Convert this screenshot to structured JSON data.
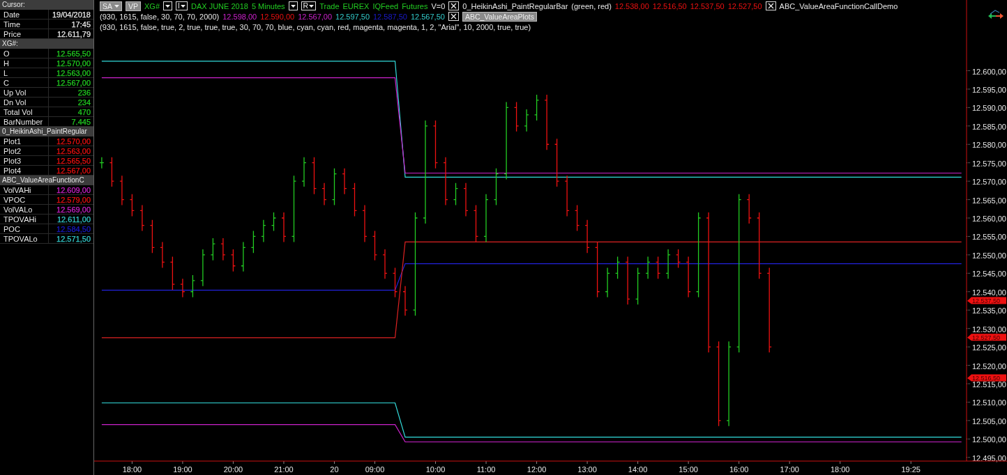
{
  "data_panel": {
    "sections": [
      {
        "title": "Cursor:",
        "rows": [
          {
            "label": "Date",
            "value": "19/04/2018",
            "color": "#e8e8e8"
          },
          {
            "label": "Time",
            "value": "17:45",
            "color": "#e8e8e8"
          },
          {
            "label": "Price",
            "value": "12.611,79",
            "color": "#e8e8e8"
          }
        ]
      },
      {
        "title": "XG#:",
        "rows": [
          {
            "label": "O",
            "value": "12.565,50",
            "color": "#22cc22"
          },
          {
            "label": "H",
            "value": "12.570,00",
            "color": "#22cc22"
          },
          {
            "label": "L",
            "value": "12.563,00",
            "color": "#22cc22"
          },
          {
            "label": "C",
            "value": "12.567,00",
            "color": "#22cc22"
          },
          {
            "label": "Up Vol",
            "value": "236",
            "color": "#22cc22"
          },
          {
            "label": "Dn Vol",
            "value": "234",
            "color": "#22cc22"
          },
          {
            "label": "Total Vol",
            "value": "470",
            "color": "#22cc22"
          },
          {
            "label": "BarNumber",
            "value": "7.445",
            "color": "#22cc22"
          }
        ]
      },
      {
        "title": "0_HeikinAshi_PaintRegular",
        "rows": [
          {
            "label": "Plot1",
            "value": "12.570,00",
            "color": "#ee1111"
          },
          {
            "label": "Plot2",
            "value": "12.563,00",
            "color": "#ee1111"
          },
          {
            "label": "Plot3",
            "value": "12.565,50",
            "color": "#ee1111"
          },
          {
            "label": "Plot4",
            "value": "12.567,00",
            "color": "#ee1111"
          }
        ]
      },
      {
        "title": "ABC_ValueAreaFunctionC",
        "rows": [
          {
            "label": "VolVAHi",
            "value": "12.609,00",
            "color": "#cc22cc"
          },
          {
            "label": "VPOC",
            "value": "12.579,00",
            "color": "#ee1111"
          },
          {
            "label": "VolVALo",
            "value": "12.569,00",
            "color": "#cc22cc"
          },
          {
            "label": "TPOVAHi",
            "value": "12.611,00",
            "color": "#33cccc"
          },
          {
            "label": "POC",
            "value": "12.584,50",
            "color": "#1a1acc"
          },
          {
            "label": "TPOVALo",
            "value": "12.571,50",
            "color": "#33cccc"
          }
        ]
      }
    ]
  },
  "legend": {
    "lines": [
      [
        {
          "kind": "button",
          "label": "SA",
          "dropdown": true
        },
        {
          "kind": "button",
          "label": "VP",
          "dropdown": false
        },
        {
          "kind": "text",
          "label": "XG#",
          "color": "#22cc22"
        },
        {
          "kind": "dropdown"
        },
        {
          "kind": "box",
          "label": "I",
          "dropdown": true
        },
        {
          "kind": "text",
          "label": "DAX JUNE 2018",
          "color": "#22cc22"
        },
        {
          "kind": "text",
          "label": "5 Minutes",
          "color": "#22cc22"
        },
        {
          "kind": "dropdown"
        },
        {
          "kind": "box",
          "label": "R",
          "dropdown": true
        },
        {
          "kind": "text",
          "label": "Trade",
          "color": "#22cc22"
        },
        {
          "kind": "text",
          "label": "EUREX",
          "color": "#22cc22"
        },
        {
          "kind": "text",
          "label": "IQFeed",
          "color": "#22cc22"
        },
        {
          "kind": "text",
          "label": "Futures",
          "color": "#22cc22"
        },
        {
          "kind": "text",
          "label": "V=0",
          "color": "#e8e8e8"
        },
        {
          "kind": "close"
        },
        {
          "kind": "text",
          "label": "0_HeikinAshi_PaintRegularBar",
          "color": "#e8e8e8"
        },
        {
          "kind": "text",
          "label": "(green, red)",
          "color": "#e8e8e8"
        },
        {
          "kind": "text",
          "label": "12.538,00",
          "color": "#ee1111"
        },
        {
          "kind": "text",
          "label": "12.516,50",
          "color": "#ee1111"
        },
        {
          "kind": "text",
          "label": "12.537,50",
          "color": "#ee1111"
        },
        {
          "kind": "text",
          "label": "12.527,50",
          "color": "#ee1111"
        },
        {
          "kind": "close"
        },
        {
          "kind": "text",
          "label": "ABC_ValueAreaFunctionCallDemo",
          "color": "#e8e8e8"
        }
      ],
      [
        {
          "kind": "text",
          "label": "(930, 1615, false, 30, 70, 70, 2000)",
          "color": "#e8e8e8"
        },
        {
          "kind": "text",
          "label": "12.598,00",
          "color": "#cc22cc"
        },
        {
          "kind": "text",
          "label": "12.590,00",
          "color": "#ee1111"
        },
        {
          "kind": "text",
          "label": "12.567,00",
          "color": "#cc22cc"
        },
        {
          "kind": "text",
          "label": "12.597,50",
          "color": "#33cccc"
        },
        {
          "kind": "text",
          "label": "12.587,50",
          "color": "#1a1acc"
        },
        {
          "kind": "text",
          "label": "12.567,50",
          "color": "#33cccc"
        },
        {
          "kind": "close"
        },
        {
          "kind": "button",
          "label": "ABC_ValueAreaPlots",
          "dropdown": false
        }
      ],
      [
        {
          "kind": "text",
          "label": "(930, 1615, false, true, 2, true, true, true, 30, 70, 70, blue, cyan, cyan, red, magenta, magenta, 1, 2, \"Arial\", 10, 2000, true, true)",
          "color": "#e8e8e8"
        }
      ]
    ]
  },
  "chart": {
    "chart_data": {
      "type": "line",
      "ylim": [
        12494,
        12619.2
      ],
      "categories": [
        null,
        null,
        null,
        "18:00",
        null,
        null,
        null,
        null,
        "19:00",
        null,
        null,
        null,
        null,
        "20:00",
        null,
        null,
        null,
        null,
        "21:00",
        null,
        null,
        null,
        null,
        "20",
        null,
        null,
        null,
        "09:00",
        null,
        null,
        null,
        null,
        null,
        "10:00",
        null,
        null,
        null,
        null,
        "11:00",
        null,
        null,
        null,
        null,
        "12:00",
        null,
        null,
        null,
        null,
        "13:00",
        null,
        null,
        null,
        null,
        "14:00",
        null,
        null,
        null,
        null,
        "15:00",
        null,
        null,
        null,
        null,
        "16:00",
        null,
        null,
        null,
        null,
        "17:00",
        null,
        null,
        null,
        null,
        "18:00",
        null,
        null,
        null,
        null,
        null,
        null,
        "19:25",
        null,
        null,
        null,
        null,
        null
      ],
      "yticks": [
        {
          "value": 12600,
          "label": "12.600,00"
        },
        {
          "value": 12595,
          "label": "12.595,00"
        },
        {
          "value": 12590,
          "label": "12.590,00"
        },
        {
          "value": 12585,
          "label": "12.585,00"
        },
        {
          "value": 12580,
          "label": "12.580,00"
        },
        {
          "value": 12575,
          "label": "12.575,00"
        },
        {
          "value": 12570,
          "label": "12.570,00"
        },
        {
          "value": 12565,
          "label": "12.565,00"
        },
        {
          "value": 12560,
          "label": "12.560,00"
        },
        {
          "value": 12555,
          "label": "12.555,00"
        },
        {
          "value": 12550,
          "label": "12.550,00"
        },
        {
          "value": 12545,
          "label": "12.545,00"
        },
        {
          "value": 12540,
          "label": "12.540,00"
        },
        {
          "value": 12535,
          "label": "12.535,00"
        },
        {
          "value": 12530,
          "label": "12.530,00"
        },
        {
          "value": 12525,
          "label": "12.525,00"
        },
        {
          "value": 12520,
          "label": "12.520,00"
        },
        {
          "value": 12515,
          "label": "12.515,00"
        },
        {
          "value": 12510,
          "label": "12.510,00"
        },
        {
          "value": 12505,
          "label": "12.505,00"
        },
        {
          "value": 12500,
          "label": "12.500,00"
        },
        {
          "value": 12495,
          "label": "12.495,00"
        }
      ],
      "series": [
        {
          "color": "#33dddd",
          "values": [
            12602.6,
            12602.6,
            12602.6,
            12602.6,
            12602.6,
            12602.6,
            12602.6,
            12602.6,
            12602.6,
            12602.6,
            12602.6,
            12602.6,
            12602.6,
            12602.6,
            12602.6,
            12602.6,
            12602.6,
            12602.6,
            12602.6,
            12602.6,
            12602.6,
            12602.6,
            12602.6,
            12602.6,
            12602.6,
            12602.6,
            12602.6,
            12602.6,
            12602.6,
            12602.6,
            12571.1,
            12571.1,
            12571.1,
            12571.1,
            12571.1,
            12571.1,
            12571.1,
            12571.1,
            12571.1,
            12571.1,
            12571.1,
            12571.1,
            12571.1,
            12571.1,
            12571.1,
            12571.1,
            12571.1,
            12571.1,
            12571.1,
            12571.1,
            12571.1,
            12571.1,
            12571.1,
            12571.1,
            12571.1,
            12571.1,
            12571.1,
            12571.1,
            12571.1,
            12571.1,
            12571.1,
            12571.1,
            12571.1,
            12571.1,
            12571.1,
            12571.1,
            12571.1,
            12571.1,
            12571.1,
            12571.1,
            12571.1,
            12571.1,
            12571.1,
            12571.1,
            12571.1,
            12571.1,
            12571.1,
            12571.1,
            12571.1,
            12571.1,
            12571.1,
            12571.1,
            12571.1,
            12571.1,
            12571.1,
            12571.1
          ]
        },
        {
          "color": "#cc22cc",
          "values": [
            12598.1,
            12598.1,
            12598.1,
            12598.1,
            12598.1,
            12598.1,
            12598.1,
            12598.1,
            12598.1,
            12598.1,
            12598.1,
            12598.1,
            12598.1,
            12598.1,
            12598.1,
            12598.1,
            12598.1,
            12598.1,
            12598.1,
            12598.1,
            12598.1,
            12598.1,
            12598.1,
            12598.1,
            12598.1,
            12598.1,
            12598.1,
            12598.1,
            12598.1,
            12598.1,
            12572.2,
            12572.2,
            12572.2,
            12572.2,
            12572.2,
            12572.2,
            12572.2,
            12572.2,
            12572.2,
            12572.2,
            12572.2,
            12572.2,
            12572.2,
            12572.2,
            12572.2,
            12572.2,
            12572.2,
            12572.2,
            12572.2,
            12572.2,
            12572.2,
            12572.2,
            12572.2,
            12572.2,
            12572.2,
            12572.2,
            12572.2,
            12572.2,
            12572.2,
            12572.2,
            12572.2,
            12572.2,
            12572.2,
            12572.2,
            12572.2,
            12572.2,
            12572.2,
            12572.2,
            12572.2,
            12572.2,
            12572.2,
            12572.2,
            12572.2,
            12572.2,
            12572.2,
            12572.2,
            12572.2,
            12572.2,
            12572.2,
            12572.2,
            12572.2,
            12572.2,
            12572.2,
            12572.2,
            12572.2,
            12572.2
          ]
        },
        {
          "color": "#2222dd",
          "values": [
            12540.4,
            12540.4,
            12540.4,
            12540.4,
            12540.4,
            12540.4,
            12540.4,
            12540.4,
            12540.4,
            12540.4,
            12540.4,
            12540.4,
            12540.4,
            12540.4,
            12540.4,
            12540.4,
            12540.4,
            12540.4,
            12540.4,
            12540.4,
            12540.4,
            12540.4,
            12540.4,
            12540.4,
            12540.4,
            12540.4,
            12540.4,
            12540.4,
            12540.4,
            12540.4,
            12547.6,
            12547.6,
            12547.6,
            12547.6,
            12547.6,
            12547.6,
            12547.6,
            12547.6,
            12547.6,
            12547.6,
            12547.6,
            12547.6,
            12547.6,
            12547.6,
            12547.6,
            12547.6,
            12547.6,
            12547.6,
            12547.6,
            12547.6,
            12547.6,
            12547.6,
            12547.6,
            12547.6,
            12547.6,
            12547.6,
            12547.6,
            12547.6,
            12547.6,
            12547.6,
            12547.6,
            12547.6,
            12547.6,
            12547.6,
            12547.6,
            12547.6,
            12547.6,
            12547.6,
            12547.6,
            12547.6,
            12547.6,
            12547.6,
            12547.6,
            12547.6,
            12547.6,
            12547.6,
            12547.6,
            12547.6,
            12547.6,
            12547.6,
            12547.6,
            12547.6,
            12547.6,
            12547.6,
            12547.6,
            12547.6
          ]
        },
        {
          "color": "#dd2222",
          "values": [
            12527.5,
            12527.5,
            12527.5,
            12527.5,
            12527.5,
            12527.5,
            12527.5,
            12527.5,
            12527.5,
            12527.5,
            12527.5,
            12527.5,
            12527.5,
            12527.5,
            12527.5,
            12527.5,
            12527.5,
            12527.5,
            12527.5,
            12527.5,
            12527.5,
            12527.5,
            12527.5,
            12527.5,
            12527.5,
            12527.5,
            12527.5,
            12527.5,
            12527.5,
            12527.5,
            12553.5,
            12553.5,
            12553.5,
            12553.5,
            12553.5,
            12553.5,
            12553.5,
            12553.5,
            12553.5,
            12553.5,
            12553.5,
            12553.5,
            12553.5,
            12553.5,
            12553.5,
            12553.5,
            12553.5,
            12553.5,
            12553.5,
            12553.5,
            12553.5,
            12553.5,
            12553.5,
            12553.5,
            12553.5,
            12553.5,
            12553.5,
            12553.5,
            12553.5,
            12553.5,
            12553.5,
            12553.5,
            12553.5,
            12553.5,
            12553.5,
            12553.5,
            12553.5,
            12553.5,
            12553.5,
            12553.5,
            12553.5,
            12553.5,
            12553.5,
            12553.5,
            12553.5,
            12553.5,
            12553.5,
            12553.5,
            12553.5,
            12553.5,
            12553.5,
            12553.5,
            12553.5,
            12553.5,
            12553.5,
            12553.5
          ]
        },
        {
          "color": "#33dddd",
          "values": [
            12509.8,
            12509.8,
            12509.8,
            12509.8,
            12509.8,
            12509.8,
            12509.8,
            12509.8,
            12509.8,
            12509.8,
            12509.8,
            12509.8,
            12509.8,
            12509.8,
            12509.8,
            12509.8,
            12509.8,
            12509.8,
            12509.8,
            12509.8,
            12509.8,
            12509.8,
            12509.8,
            12509.8,
            12509.8,
            12509.8,
            12509.8,
            12509.8,
            12509.8,
            12509.8,
            12500.5,
            12500.5,
            12500.5,
            12500.5,
            12500.5,
            12500.5,
            12500.5,
            12500.5,
            12500.5,
            12500.5,
            12500.5,
            12500.5,
            12500.5,
            12500.5,
            12500.5,
            12500.5,
            12500.5,
            12500.5,
            12500.5,
            12500.5,
            12500.5,
            12500.5,
            12500.5,
            12500.5,
            12500.5,
            12500.5,
            12500.5,
            12500.5,
            12500.5,
            12500.5,
            12500.5,
            12500.5,
            12500.5,
            12500.5,
            12500.5,
            12500.5,
            12500.5,
            12500.5,
            12500.5,
            12500.5,
            12500.5,
            12500.5,
            12500.5,
            12500.5,
            12500.5,
            12500.5,
            12500.5,
            12500.5,
            12500.5,
            12500.5,
            12500.5,
            12500.5,
            12500.5,
            12500.5,
            12500.5,
            12500.5
          ]
        },
        {
          "color": "#cc22cc",
          "values": [
            12503.9,
            12503.9,
            12503.9,
            12503.9,
            12503.9,
            12503.9,
            12503.9,
            12503.9,
            12503.9,
            12503.9,
            12503.9,
            12503.9,
            12503.9,
            12503.9,
            12503.9,
            12503.9,
            12503.9,
            12503.9,
            12503.9,
            12503.9,
            12503.9,
            12503.9,
            12503.9,
            12503.9,
            12503.9,
            12503.9,
            12503.9,
            12503.9,
            12503.9,
            12503.9,
            12499.2,
            12499.2,
            12499.2,
            12499.2,
            12499.2,
            12499.2,
            12499.2,
            12499.2,
            12499.2,
            12499.2,
            12499.2,
            12499.2,
            12499.2,
            12499.2,
            12499.2,
            12499.2,
            12499.2,
            12499.2,
            12499.2,
            12499.2,
            12499.2,
            12499.2,
            12499.2,
            12499.2,
            12499.2,
            12499.2,
            12499.2,
            12499.2,
            12499.2,
            12499.2,
            12499.2,
            12499.2,
            12499.2,
            12499.2,
            12499.2,
            12499.2,
            12499.2,
            12499.2,
            12499.2,
            12499.2,
            12499.2,
            12499.2,
            12499.2,
            12499.2,
            12499.2,
            12499.2,
            12499.2,
            12499.2,
            12499.2,
            12499.2,
            12499.2,
            12499.2,
            12499.2,
            12499.2,
            12499.2,
            12499.2
          ]
        }
      ],
      "annotations": [
        "12.537,50",
        "12.527,50",
        "12.516,50"
      ]
    }
  }
}
